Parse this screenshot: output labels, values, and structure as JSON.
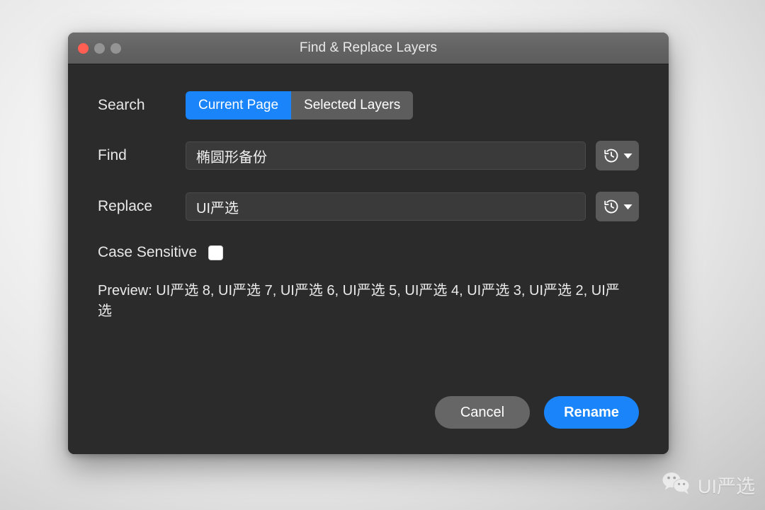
{
  "window": {
    "title": "Find & Replace Layers",
    "traffic_lights": [
      {
        "name": "close",
        "color": "#ff5f52"
      },
      {
        "name": "minimize",
        "color": "#949494"
      },
      {
        "name": "maximize",
        "color": "#949494"
      }
    ]
  },
  "form": {
    "search": {
      "label": "Search",
      "segments": [
        {
          "label": "Current Page",
          "selected": true
        },
        {
          "label": "Selected Layers",
          "selected": false
        }
      ]
    },
    "find": {
      "label": "Find",
      "value": "椭圆形备份",
      "placeholder": "",
      "history_icon": "history-clock-icon",
      "dropdown_icon": "chevron-down-icon"
    },
    "replace": {
      "label": "Replace",
      "value": "UI严选",
      "placeholder": "",
      "history_icon": "history-clock-icon",
      "dropdown_icon": "chevron-down-icon"
    },
    "case_sensitive": {
      "label": "Case Sensitive",
      "checked": false
    },
    "preview": {
      "text": "Preview: UI严选 8, UI严选 7, UI严选 6, UI严选 5, UI严选 4, UI严选 3, UI严选 2, UI严选"
    }
  },
  "footer": {
    "cancel_label": "Cancel",
    "rename_label": "Rename"
  },
  "watermark": {
    "text": "UI严选",
    "icon": "wechat-icon"
  },
  "colors": {
    "accent": "#1a84fb",
    "window_background": "#2b2b2b",
    "titlebar": "#636363",
    "input_background": "#3a3a3a",
    "segment_inactive": "#5d5d5d",
    "cancel_button": "#666666"
  }
}
